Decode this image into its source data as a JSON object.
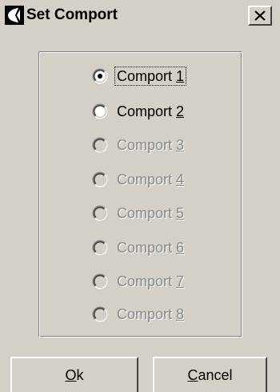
{
  "window": {
    "title": "Set Comport",
    "close_glyph": "X",
    "icon": "app-logo-icon"
  },
  "comports": [
    {
      "prefix": "Comport ",
      "accel": "1",
      "selected": true,
      "enabled": true
    },
    {
      "prefix": "Comport ",
      "accel": "2",
      "selected": false,
      "enabled": true
    },
    {
      "prefix": "Comport ",
      "accel": "3",
      "selected": false,
      "enabled": false
    },
    {
      "prefix": "Comport ",
      "accel": "4",
      "selected": false,
      "enabled": false
    },
    {
      "prefix": "Comport ",
      "accel": "5",
      "selected": false,
      "enabled": false
    },
    {
      "prefix": "Comport ",
      "accel": "6",
      "selected": false,
      "enabled": false
    },
    {
      "prefix": "Comport ",
      "accel": "7",
      "selected": false,
      "enabled": false
    },
    {
      "prefix": "Comport ",
      "accel": "8",
      "selected": false,
      "enabled": false
    }
  ],
  "buttons": {
    "ok": {
      "accel": "O",
      "rest": "k"
    },
    "cancel": {
      "accel": "C",
      "rest": "ancel"
    }
  },
  "colors": {
    "face": "#d4d0c8",
    "disabled_text": "#888888"
  }
}
